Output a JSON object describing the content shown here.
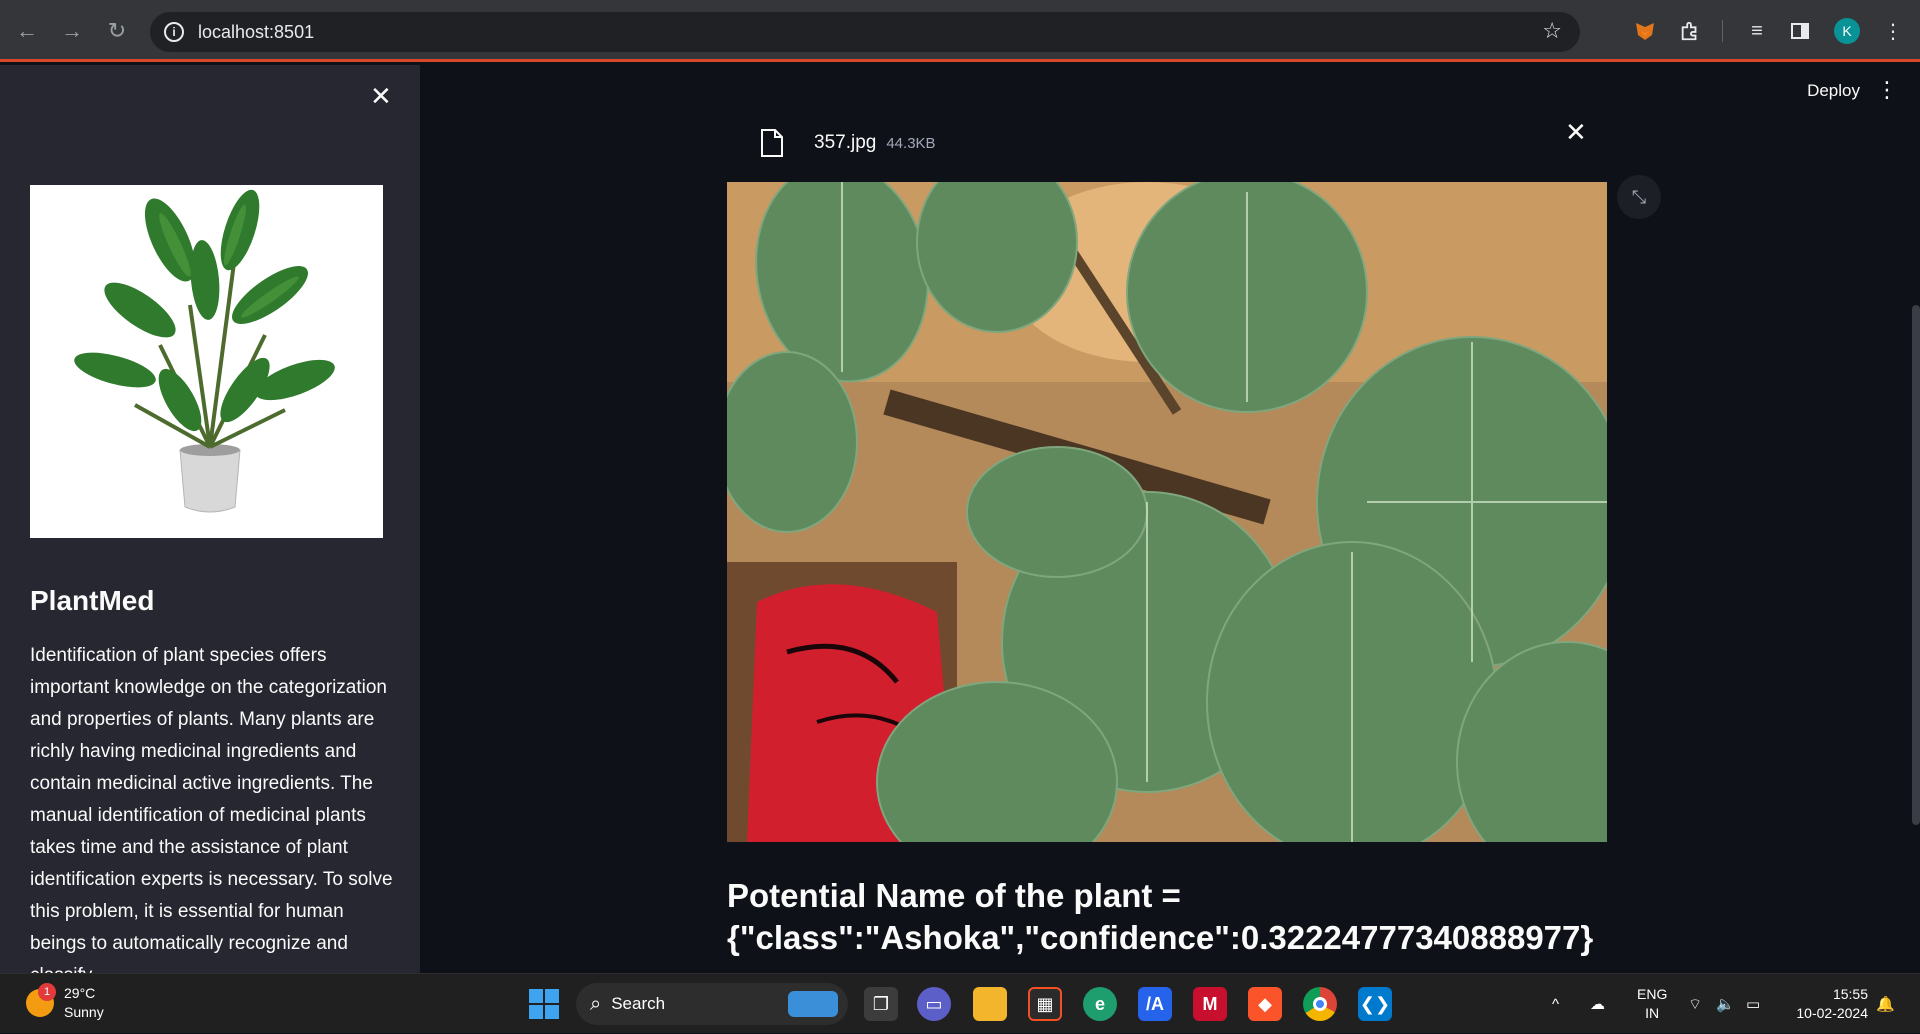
{
  "browser": {
    "url": "localhost:8501",
    "profile_initial": "K",
    "icons": [
      "back-icon",
      "forward-icon",
      "reload-icon",
      "info-icon",
      "star-icon",
      "fox-extension-icon",
      "puzzle-extensions-icon",
      "media-queue-icon",
      "side-panel-icon",
      "menu-kebab-icon"
    ]
  },
  "sidebar": {
    "close_glyph": "✕",
    "title": "PlantMed",
    "description": "Identification of plant species offers important knowledge on the categorization and properties of plants. Many plants are richly having medicinal ingredients and contain medicinal active ingredients. The manual identification of medicinal plants takes time and the assistance of plant identification experts is necessary. To solve this problem, it is essential for human beings to automatically recognize and classify"
  },
  "main": {
    "deploy_label": "Deploy",
    "kebab_glyph": "⋮",
    "file": {
      "name": "357.jpg",
      "size": "44.3KB",
      "remove_glyph": "✕"
    },
    "fullscreen_glyph": "⤡",
    "result_line1": "Potential Name of the plant =",
    "result_line2": "{\"class\":\"Ashoka\",\"confidence\":0.32224777340888977}"
  },
  "taskbar": {
    "weather": {
      "badge": "1",
      "temp": "29°C",
      "condition": "Sunny"
    },
    "search_label": "Search",
    "apps": [
      "widgets-icon",
      "task-view-icon",
      "teams-chat-icon",
      "file-explorer-icon",
      "store-icon",
      "edge-icon",
      "terminal-app-icon",
      "mcafee-icon",
      "brave-icon",
      "chrome-icon",
      "vscode-icon"
    ],
    "tray": {
      "chevron": "^",
      "lang_top": "ENG",
      "lang_bottom": "IN",
      "time": "15:55",
      "date": "10-02-2024"
    }
  },
  "colors": {
    "accent_bar": "#d9482b",
    "sidebar_bg": "#262730",
    "main_bg": "#0e1117"
  }
}
